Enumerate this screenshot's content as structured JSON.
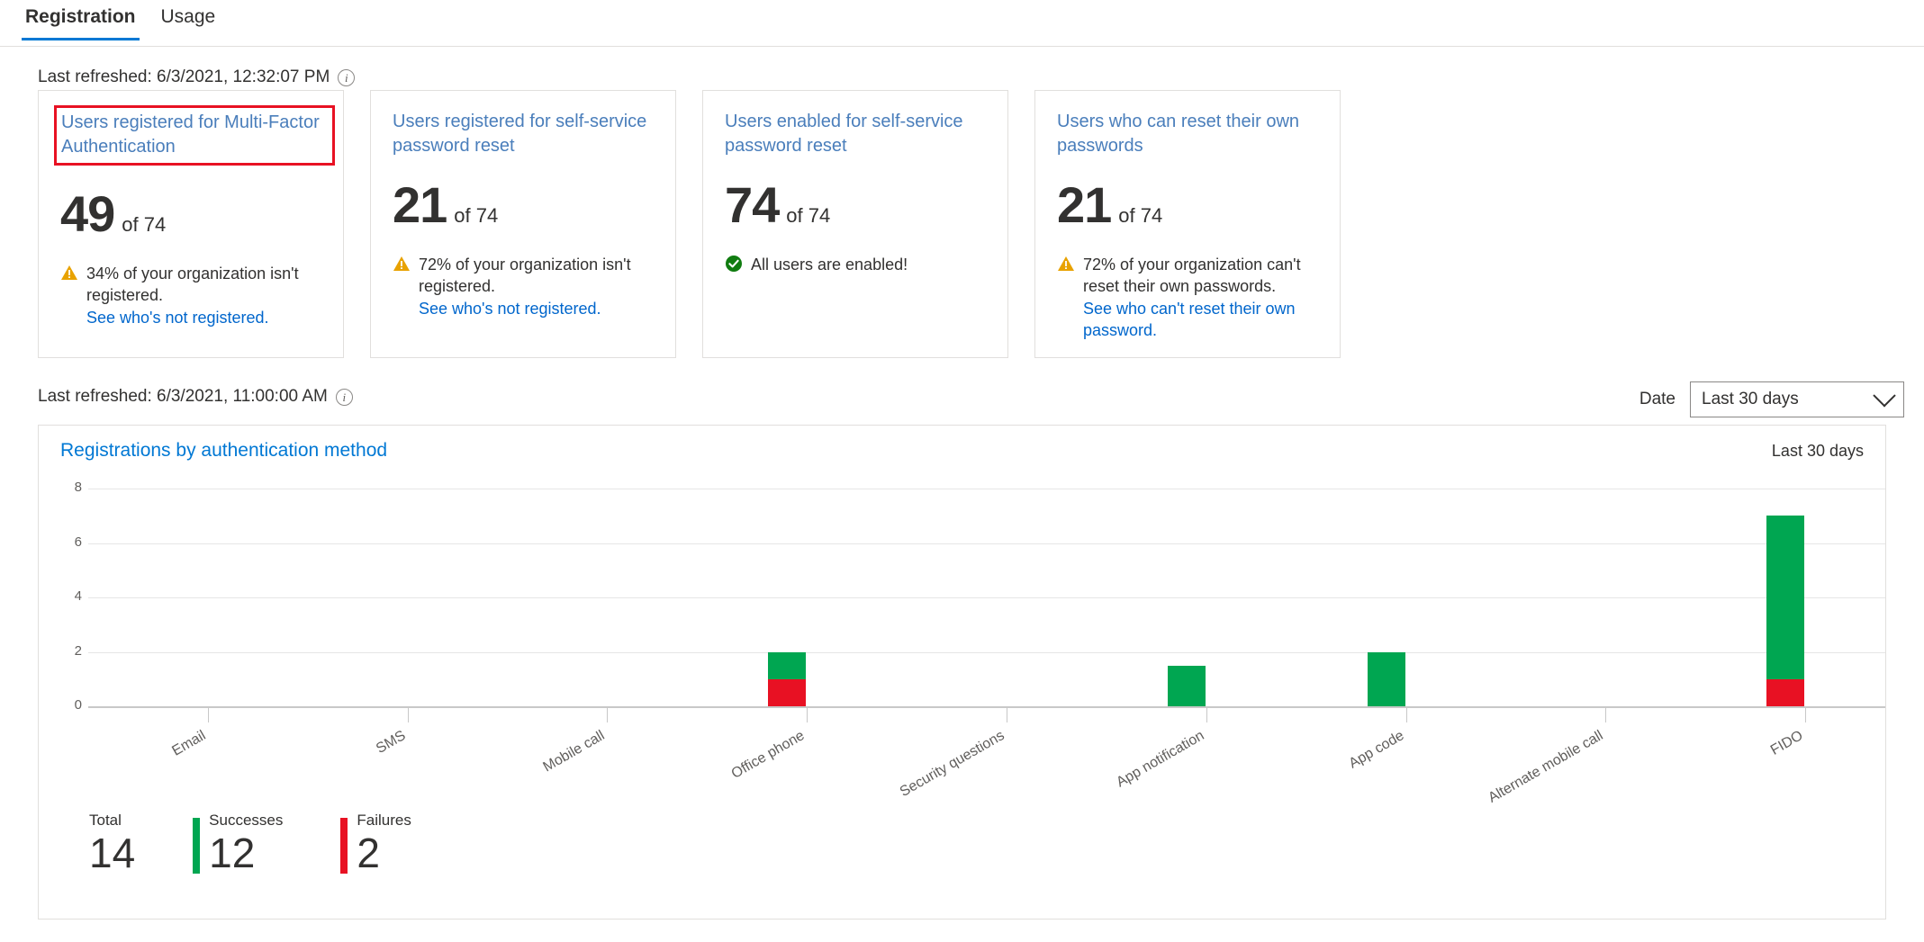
{
  "tabs": [
    {
      "label": "Registration",
      "active": true
    },
    {
      "label": "Usage",
      "active": false
    }
  ],
  "refresh_top": {
    "text": "Last refreshed: 6/3/2021, 12:32:07 PM",
    "info_icon": "info-icon",
    "info_glyph": "i"
  },
  "refresh_chart": {
    "text": "Last refreshed: 6/3/2021, 11:00:00 AM",
    "info_icon": "info-icon",
    "info_glyph": "i"
  },
  "cards": [
    {
      "title": "Users registered for Multi-Factor Authentication",
      "highlighted": true,
      "highlight_color": "#e81123",
      "value": "49",
      "of": "of 74",
      "status_icon": "warning-icon",
      "status_color": "#e8a200",
      "note": "34% of your organization isn't registered.",
      "link": "See who's not registered."
    },
    {
      "title": "Users registered for self-service password reset",
      "highlighted": false,
      "value": "21",
      "of": "of 74",
      "status_icon": "warning-icon",
      "status_color": "#e8a200",
      "note": "72% of your organization isn't registered.",
      "link": "See who's not registered."
    },
    {
      "title": "Users enabled for self-service password reset",
      "highlighted": false,
      "value": "74",
      "of": "of 74",
      "status_icon": "success-check-icon",
      "status_color": "#107c10",
      "note": "All users are enabled!",
      "link": ""
    },
    {
      "title": "Users who can reset their own passwords",
      "highlighted": false,
      "value": "21",
      "of": "of 74",
      "status_icon": "warning-icon",
      "status_color": "#e8a200",
      "note": "72% of your organization can't reset their own passwords.",
      "link": "See who can't reset their own password."
    }
  ],
  "date_filter": {
    "label": "Date",
    "value": "Last 30 days",
    "chevron_icon": "chevron-down-icon"
  },
  "panel": {
    "title": "Registrations by authentication method",
    "range": "Last 30 days"
  },
  "summary": [
    {
      "label": "Total",
      "value": "14",
      "color": ""
    },
    {
      "label": "Successes",
      "value": "12",
      "color": "#00a651"
    },
    {
      "label": "Failures",
      "value": "2",
      "color": "#e81123"
    }
  ],
  "chart_data": {
    "type": "bar",
    "title": "Registrations by authentication method",
    "subtitle": "Last 30 days",
    "stacked": true,
    "xlabel": "",
    "ylabel": "",
    "ylim": [
      0,
      8
    ],
    "yticks": [
      0,
      2,
      4,
      6,
      8
    ],
    "grid": true,
    "legend_position": "bottom",
    "categories": [
      "Email",
      "SMS",
      "Mobile call",
      "Office phone",
      "Security questions",
      "App notification",
      "App code",
      "Alternate mobile call",
      "FIDO"
    ],
    "series": [
      {
        "name": "Failures",
        "color": "#e81123",
        "values": [
          0,
          0,
          0,
          1,
          0,
          0,
          0,
          0,
          1
        ]
      },
      {
        "name": "Successes",
        "color": "#00a651",
        "values": [
          0,
          0,
          0,
          1,
          0,
          1.5,
          2,
          0,
          6
        ]
      }
    ],
    "totals": {
      "total": 14,
      "successes": 12,
      "failures": 2
    }
  }
}
